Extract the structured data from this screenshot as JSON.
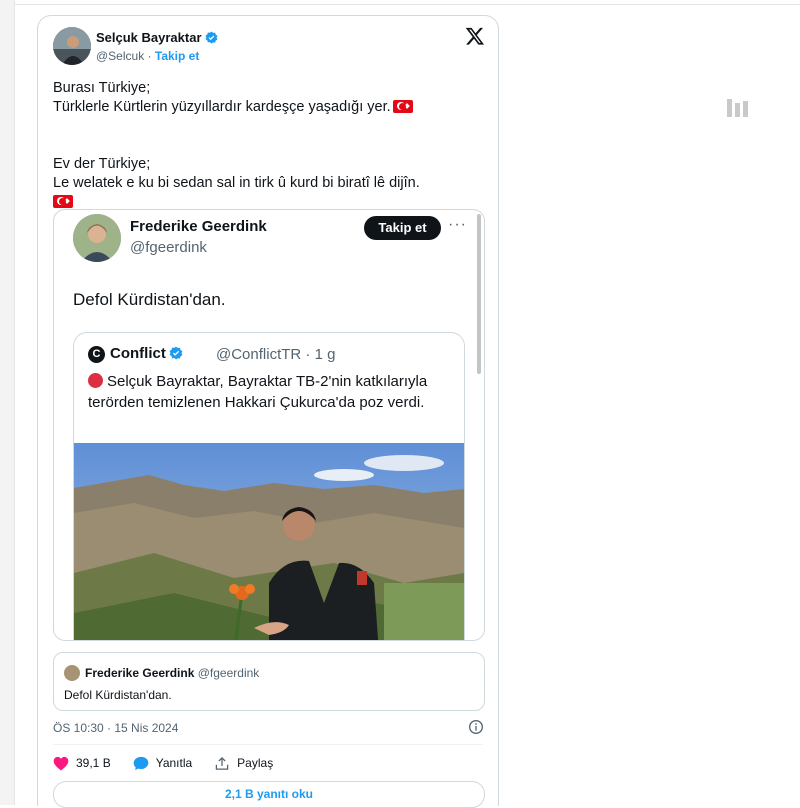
{
  "author": {
    "name": "Selçuk Bayraktar",
    "handle": "@Selcuk",
    "separator": "·",
    "follow_label": "Takip et"
  },
  "tweet": {
    "lines": [
      "Burası Türkiye;",
      "Türklerle Kürtlerin yüzyıllardır kardeşçe yaşadığı yer.",
      "",
      "Ev der Türkiye;",
      "Le welatek e ku bi sedan sal in tirk û kurd bi biratî lê dijîn."
    ]
  },
  "embed": {
    "author_name": "Frederike Geerdink",
    "author_handle": "@fgeerdink",
    "follow_label": "Takip et",
    "more": "···",
    "text": "Defol Kürdistan'dan.",
    "quote": {
      "logo_letter": "C",
      "name": "Conflict",
      "handle_time": "@ConflictTR · 1 g",
      "text": "Selçuk Bayraktar, Bayraktar TB-2'nin katkılarıyla terörden temizlenen Hakkari Çukurca'da poz verdi."
    }
  },
  "quoted": {
    "name": "Frederike Geerdink",
    "handle": "@fgeerdink",
    "text": "Defol Kürdistan'dan."
  },
  "timestamp": "ÖS 10:30 · 15 Nis 2024",
  "actions": {
    "likes": "39,1 B",
    "reply_label": "Yanıtla",
    "share_label": "Paylaş"
  },
  "replies_button": "2,1 B yanıtı oku",
  "colors": {
    "accent": "#1d9bf0",
    "like": "#f91880",
    "flag": "#e30a17"
  }
}
